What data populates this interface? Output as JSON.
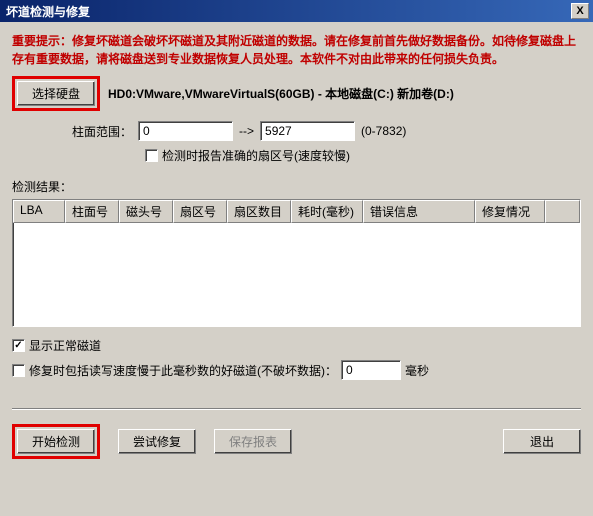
{
  "title": "坏道检测与修复",
  "close": "X",
  "warning": "重要提示：修复坏磁道会破坏坏磁道及其附近磁道的数据。请在修复前首先做好数据备份。如待修复磁盘上存有重要数据，请将磁盘送到专业数据恢复人员处理。本软件不对由此带来的任何损失负责。",
  "selectDisk": "选择硬盘",
  "diskLabel": "HD0:VMware,VMwareVirtualS(60GB) - 本地磁盘(C:) 新加卷(D:)",
  "cylinderRangeLabel": "柱面范围：",
  "rangeFrom": "0",
  "arrow": "-->",
  "rangeTo": "5927",
  "rangeHint": "(0-7832)",
  "reportAccurate": "检测时报告准确的扇区号(速度较慢)",
  "resultLabel": "检测结果：",
  "cols": {
    "lba": "LBA",
    "cylinder": "柱面号",
    "head": "磁头号",
    "sector": "扇区号",
    "count": "扇区数目",
    "time": "耗时(毫秒)",
    "error": "错误信息",
    "repair": "修复情况"
  },
  "showNormal": "显示正常磁道",
  "repairSpeedLabel": "修复时包括读写速度慢于此毫秒数的好磁道(不破坏数据)：",
  "repairSpeedValue": "0",
  "msUnit": "毫秒",
  "startDetect": "开始检测",
  "tryRepair": "尝试修复",
  "saveReport": "保存报表",
  "exit": "退出"
}
